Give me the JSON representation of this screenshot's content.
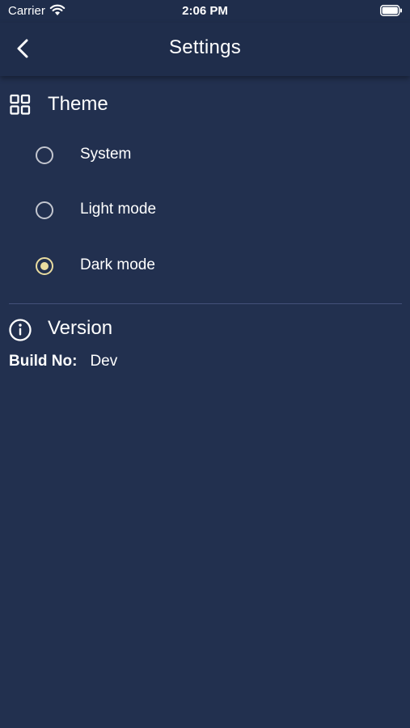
{
  "status_bar": {
    "carrier": "Carrier",
    "time": "2:06 PM",
    "icons": [
      "wifi-icon",
      "battery-icon"
    ]
  },
  "nav": {
    "title": "Settings",
    "back_icon": "chevron-left-icon"
  },
  "theme": {
    "title": "Theme",
    "icon": "grid-icon",
    "options": [
      {
        "label": "System",
        "selected": false
      },
      {
        "label": "Light mode",
        "selected": false
      },
      {
        "label": "Dark mode",
        "selected": true
      }
    ]
  },
  "version": {
    "title": "Version",
    "icon": "info-icon",
    "build_label": "Build No:",
    "build_value": "Dev"
  },
  "colors": {
    "background": "#22304f",
    "header": "#1f2d4b",
    "accent": "#e9dca0",
    "radio_unselected": "#c3c6cf",
    "divider": "#44517a",
    "text": "#ffffff"
  }
}
